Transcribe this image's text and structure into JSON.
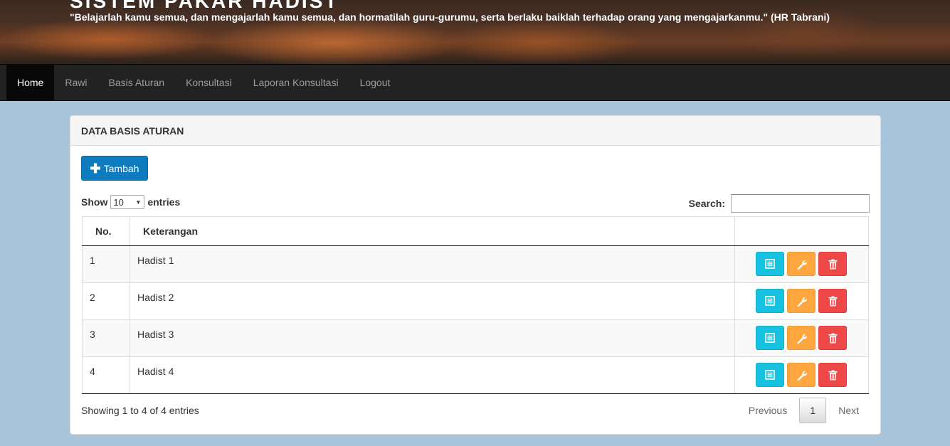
{
  "header": {
    "title": "SISTEM PAKAR HADIST",
    "quote": "\"Belajarlah kamu semua, dan mengajarlah kamu semua, dan hormatilah guru-gurumu, serta berlaku baiklah terhadap orang yang mengajarkanmu.\" (HR Tabrani)"
  },
  "nav": {
    "items": [
      {
        "label": "Home",
        "active": true
      },
      {
        "label": "Rawi"
      },
      {
        "label": "Basis Aturan"
      },
      {
        "label": "Konsultasi"
      },
      {
        "label": "Laporan Konsultasi"
      },
      {
        "label": "Logout"
      }
    ]
  },
  "panel": {
    "heading": "DATA BASIS ATURAN",
    "add_label": "Tambah",
    "length": {
      "show": "Show",
      "value": "10",
      "entries": "entries"
    },
    "search": {
      "label": "Search:",
      "value": ""
    },
    "table": {
      "headers": [
        "No.",
        "Keterangan",
        ""
      ],
      "rows": [
        {
          "no": "1",
          "keterangan": "Hadist 1"
        },
        {
          "no": "2",
          "keterangan": "Hadist 2"
        },
        {
          "no": "3",
          "keterangan": "Hadist 3"
        },
        {
          "no": "4",
          "keterangan": "Hadist 4"
        }
      ]
    },
    "info": "Showing 1 to 4 of 4 entries",
    "pagination": {
      "previous": "Previous",
      "current": "1",
      "next": "Next"
    }
  },
  "colors": {
    "page_background": "#a8c4db",
    "navbar": "#222222",
    "primary_button": "#0d7bbd",
    "view_button": "#17c1e0",
    "edit_button": "#ffa63f",
    "delete_button": "#ef4848"
  },
  "icons": {
    "add": "plus-icon",
    "view": "list-icon",
    "edit": "wrench-icon",
    "delete": "trash-icon"
  }
}
